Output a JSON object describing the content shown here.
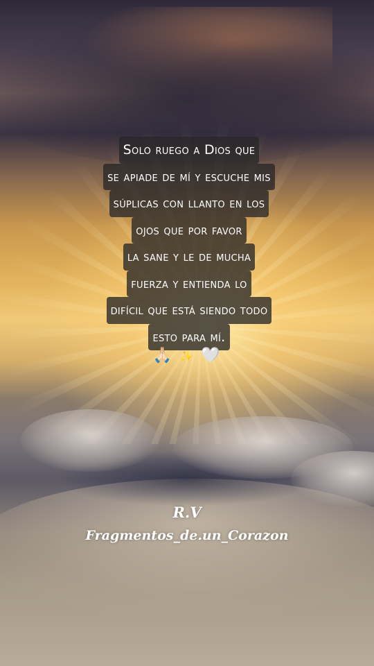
{
  "quote": {
    "lines": [
      "Solo ruego a Dios que",
      "se apiade de mí y escuche mis",
      "súplicas con llanto en los",
      "ojos que por favor",
      "la sane y le de mucha",
      "fuerza y entienda lo",
      "difícil que está siendo todo",
      "esto para mí."
    ]
  },
  "emojis": {
    "pray": "🙏🏻",
    "sparkles": "✨",
    "heart": "🤍"
  },
  "signature": {
    "initials": "R.V",
    "handle": "Fragmentos_de.un_Corazon"
  },
  "colors": {
    "text": "#ffffff",
    "text_highlight": "#28262ac7",
    "sky_glow": "#f0c978"
  }
}
